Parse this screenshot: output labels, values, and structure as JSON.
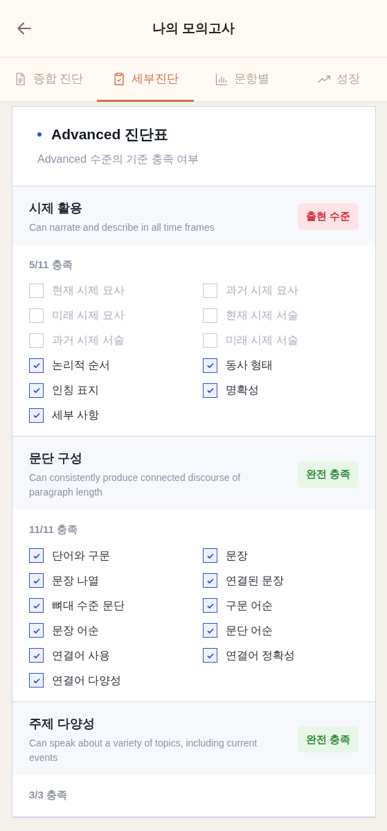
{
  "header": {
    "title": "나의 모의고사"
  },
  "tabs": [
    {
      "label": "종합 진단",
      "selected": false
    },
    {
      "label": "세부진단",
      "selected": true
    },
    {
      "label": "문항별",
      "selected": false
    },
    {
      "label": "성장",
      "selected": false
    }
  ],
  "card": {
    "title": "Advanced 진단표",
    "subtitle": "Advanced 수준의 기준 충족 여부"
  },
  "sections": [
    {
      "title": "시제 활용",
      "description": "Can narrate and describe in all time frames",
      "badge": {
        "label": "출현 수준",
        "kind": "emerging"
      },
      "count": "5/11 충족",
      "items": [
        {
          "label": "현재 시제 묘사",
          "checked": false
        },
        {
          "label": "과거 시제 묘사",
          "checked": false
        },
        {
          "label": "미래 시제 묘사",
          "checked": false
        },
        {
          "label": "현재 시제 서술",
          "checked": false
        },
        {
          "label": "과거 시제 서술",
          "checked": false
        },
        {
          "label": "미래 시제 서술",
          "checked": false
        },
        {
          "label": "논리적 순서",
          "checked": true
        },
        {
          "label": "동사 형태",
          "checked": true
        },
        {
          "label": "인칭 표지",
          "checked": true
        },
        {
          "label": "명확성",
          "checked": true
        },
        {
          "label": "세부 사항",
          "checked": true
        }
      ]
    },
    {
      "title": "문단 구성",
      "description": "Can consistently produce connected discourse of paragraph length",
      "badge": {
        "label": "완전 충족",
        "kind": "full"
      },
      "count": "11/11 충족",
      "items": [
        {
          "label": "단어와 구문",
          "checked": true
        },
        {
          "label": "문장",
          "checked": true
        },
        {
          "label": "문장 나열",
          "checked": true
        },
        {
          "label": "연결된 문장",
          "checked": true
        },
        {
          "label": "뼈대 수준 문단",
          "checked": true
        },
        {
          "label": "구문 어순",
          "checked": true
        },
        {
          "label": "문장 어순",
          "checked": true
        },
        {
          "label": "문단 어순",
          "checked": true
        },
        {
          "label": "연결어 사용",
          "checked": true
        },
        {
          "label": "연결어 정확성",
          "checked": true
        },
        {
          "label": "연결어 다양성",
          "checked": true
        }
      ]
    },
    {
      "title": "주제 다양성",
      "description": "Can speak about a variety of topics, including current events",
      "badge": {
        "label": "완전 충족",
        "kind": "full"
      },
      "count": "3/3 충족"
    }
  ]
}
